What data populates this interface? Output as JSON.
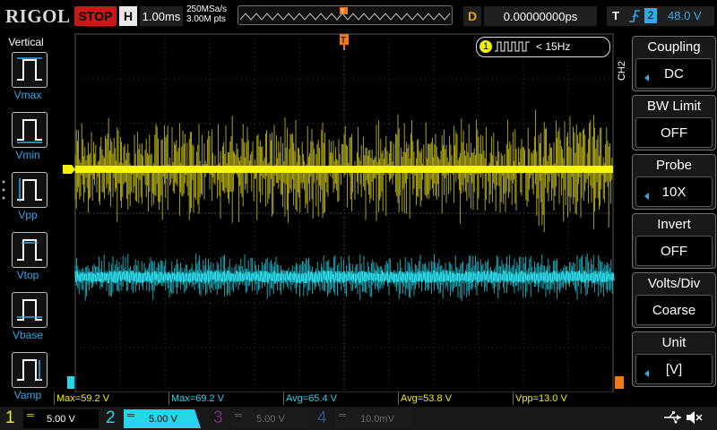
{
  "topbar": {
    "logo": "RIGOL",
    "run_state": "STOP",
    "horizontal_label": "H",
    "timebase": "1.00ms",
    "sample_rate": "250MSa/s",
    "memory_depth": "3.00M pts",
    "delay_label": "D",
    "delay_value": "0.00000000ps",
    "trigger_label": "T",
    "trigger_source": "2",
    "trigger_level": "48.0 V"
  },
  "left_panel": {
    "title": "Vertical",
    "items": [
      {
        "label": "Vmax",
        "icon": "vmax-icon"
      },
      {
        "label": "Vmin",
        "icon": "vmin-icon"
      },
      {
        "label": "Vpp",
        "icon": "vpp-icon"
      },
      {
        "label": "Vtop",
        "icon": "vtop-icon"
      },
      {
        "label": "Vbase",
        "icon": "vbase-icon"
      },
      {
        "label": "Vamp",
        "icon": "vamp-icon"
      }
    ]
  },
  "right_panel": {
    "channel_tag": "CH2",
    "menu": [
      {
        "title": "Coupling",
        "value": "DC"
      },
      {
        "title": "BW Limit",
        "value": "OFF"
      },
      {
        "title": "Probe",
        "value": "10X"
      },
      {
        "title": "Invert",
        "value": "OFF"
      },
      {
        "title": "Volts/Div",
        "value": "Coarse"
      },
      {
        "title": "Unit",
        "value": "[V]"
      }
    ]
  },
  "counter": {
    "channel": "1",
    "value": "< 15Hz"
  },
  "measurements": [
    {
      "text": "Max=59.2 V",
      "color": "#f0f000"
    },
    {
      "text": "Max=69.2 V",
      "color": "#25d6e8"
    },
    {
      "text": "Avg=65.4 V",
      "color": "#25d6e8"
    },
    {
      "text": "Avg=53.8 V",
      "color": "#f0f000"
    },
    {
      "text": "Vpp=13.0 V",
      "color": "#f0f000"
    }
  ],
  "channels": [
    {
      "num": "1",
      "scale": "5.00 V",
      "color": "#f0f000",
      "active": true
    },
    {
      "num": "2",
      "scale": "5.00 V",
      "color": "#25d6e8",
      "active": true
    },
    {
      "num": "3",
      "scale": "5.00 V",
      "color": "#c040c0",
      "active": false
    },
    {
      "num": "4",
      "scale": "10.0mV",
      "color": "#3060c0",
      "active": false
    }
  ],
  "colors": {
    "ch1": "#f0f000",
    "ch2": "#25d6e8",
    "accent": "#35a8e8",
    "trigger": "#f0a020",
    "stop": "#c81818"
  },
  "markers": {
    "trigger_marker": "T",
    "ch1_offset": "1",
    "ch2_offset": "2"
  }
}
